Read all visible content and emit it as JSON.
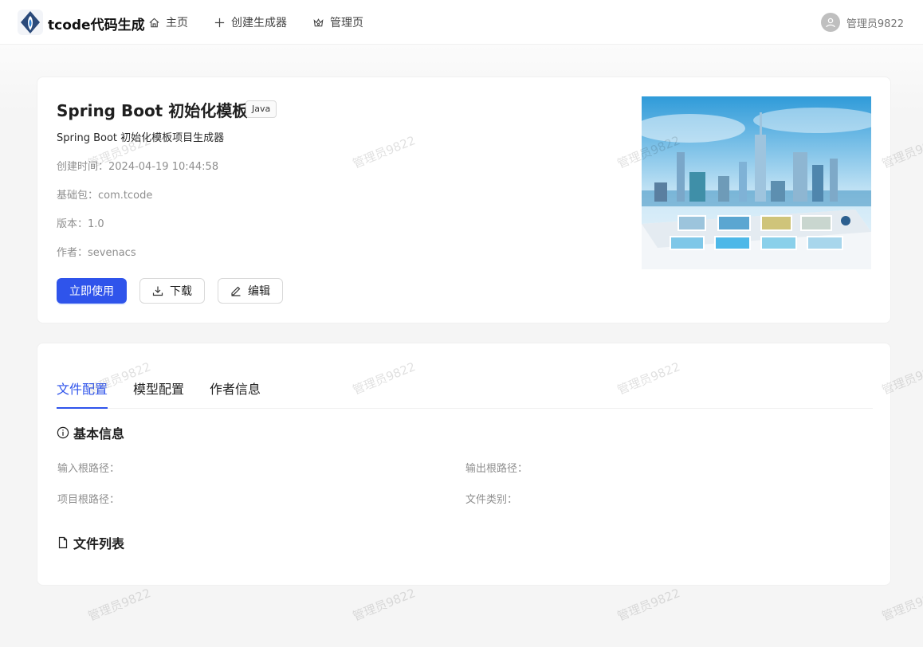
{
  "header": {
    "brand": "tcode代码生成",
    "nav": [
      {
        "label": "主页",
        "icon": "home-icon"
      },
      {
        "label": "创建生成器",
        "icon": "plus-icon"
      },
      {
        "label": "管理页",
        "icon": "crown-icon"
      }
    ],
    "user": {
      "name": "管理员9822",
      "icon": "user-avatar-icon"
    }
  },
  "generator": {
    "title": "Spring Boot 初始化模板",
    "tag": "Java",
    "description": "Spring Boot 初始化模板项目生成器",
    "created_label": "创建时间：",
    "created": "2024-04-19 10:44:58",
    "base_package_label": "基础包：",
    "base_package": "com.tcode",
    "version_label": "版本：",
    "version": "1.0",
    "author_label": "作者：",
    "author": "sevenacs",
    "buttons": {
      "use": "立即使用",
      "download": "下载",
      "edit": "编辑"
    }
  },
  "tabs": [
    {
      "label": "文件配置",
      "active": true
    },
    {
      "label": "模型配置",
      "active": false
    },
    {
      "label": "作者信息",
      "active": false
    }
  ],
  "basic_info": {
    "title": "基本信息",
    "input_root": "输入根路径：",
    "output_root": "输出根路径：",
    "project_root": "项目根路径：",
    "file_type": "文件类别："
  },
  "file_list": {
    "title": "文件列表"
  },
  "watermark": "管理员9822",
  "colors": {
    "accent": "#2f54eb",
    "background": "#f5f5f5"
  }
}
